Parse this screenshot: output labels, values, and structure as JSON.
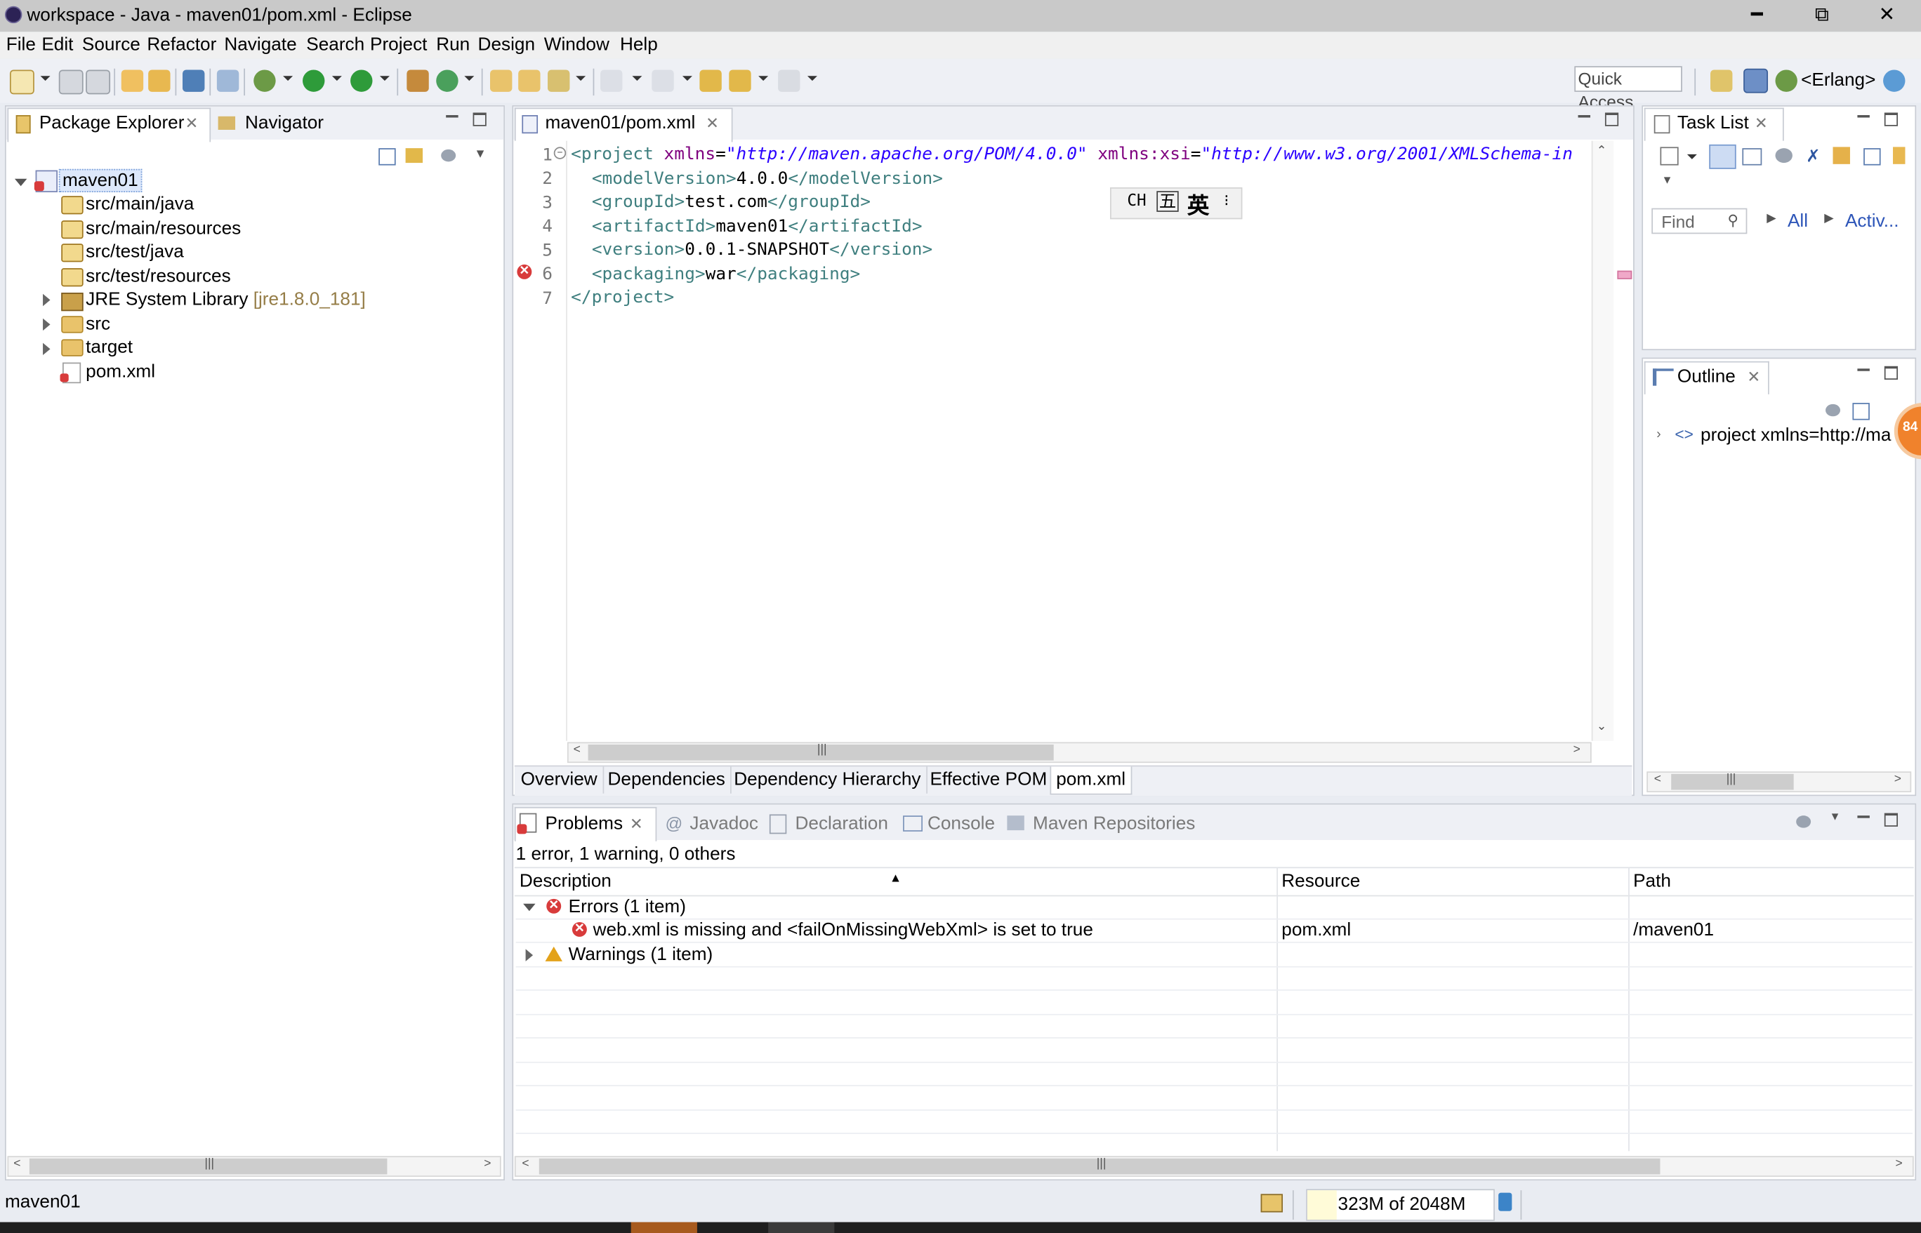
{
  "window": {
    "title": "workspace - Java - maven01/pom.xml - Eclipse",
    "controls": [
      "━",
      "⧉",
      "✕"
    ]
  },
  "menu": [
    "File",
    "Edit",
    "Source",
    "Refactor",
    "Navigate",
    "Search",
    "Project",
    "Run",
    "Design",
    "Window",
    "Help"
  ],
  "toolbar": {
    "quick_access": "Quick Access",
    "perspective": "<Erlang>"
  },
  "package_explorer": {
    "tabs": [
      "Package Explorer",
      "Navigator"
    ],
    "project": "maven01",
    "items": [
      {
        "label": "src/main/java"
      },
      {
        "label": "src/main/resources"
      },
      {
        "label": "src/test/java"
      },
      {
        "label": "src/test/resources"
      },
      {
        "label": "JRE System Library",
        "suffix": "[jre1.8.0_181]"
      },
      {
        "label": "src"
      },
      {
        "label": "target"
      },
      {
        "label": "pom.xml"
      }
    ]
  },
  "editor": {
    "tab": "maven01/pom.xml",
    "line_numbers": [
      "1",
      "2",
      "3",
      "4",
      "5",
      "6",
      "7"
    ],
    "lines": [
      {
        "open": "<project ",
        "a1": "xmlns",
        "eq1": "=",
        "v1": "\"http://maven.apache.org/POM/4.0.0\"",
        "a2": " xmlns:xsi",
        "eq2": "=",
        "v2": "\"http://www.w3.org/2001/XMLSchema-in"
      },
      {
        "t1": "<modelVersion>",
        "text": "4.0.0",
        "t2": "</modelVersion>"
      },
      {
        "t1": "<groupId>",
        "text": "test.com",
        "t2": "</groupId>"
      },
      {
        "t1": "<artifactId>",
        "text": "maven01",
        "t2": "</artifactId>"
      },
      {
        "t1": "<version>",
        "text": "0.0.1-SNAPSHOT",
        "t2": "</version>"
      },
      {
        "t1": "<packaging>",
        "text": "war",
        "t2": "</packaging>"
      },
      {
        "t1": "</project>"
      }
    ],
    "ime": {
      "mode": "CH",
      "wubi": "五",
      "lang": "英"
    },
    "bottom_tabs": [
      "Overview",
      "Dependencies",
      "Dependency Hierarchy",
      "Effective POM",
      "pom.xml"
    ]
  },
  "task_list": {
    "title": "Task List",
    "find_placeholder": "Find",
    "all": "All",
    "activ": "Activ..."
  },
  "outline": {
    "title": "Outline",
    "item": "project xmlns=http://ma",
    "badge": "84"
  },
  "problems": {
    "tabs": [
      "Problems",
      "Javadoc",
      "Declaration",
      "Console",
      "Maven Repositories"
    ],
    "summary": "1 error, 1 warning, 0 others",
    "columns": [
      "Description",
      "Resource",
      "Path"
    ],
    "errors_group": "Errors (1 item)",
    "error_row": {
      "description": "web.xml is missing and <failOnMissingWebXml> is set to true",
      "resource": "pom.xml",
      "path": "/maven01"
    },
    "warnings_group": "Warnings (1 item)"
  },
  "status": {
    "selection": "maven01",
    "heap": "323M of 2048M"
  },
  "colors": {
    "tag": "#3f7f7f",
    "attr_name": "#7f007f",
    "attr_value": "#2a00ff",
    "error": "#d83b3b",
    "warning": "#e3a21a"
  }
}
